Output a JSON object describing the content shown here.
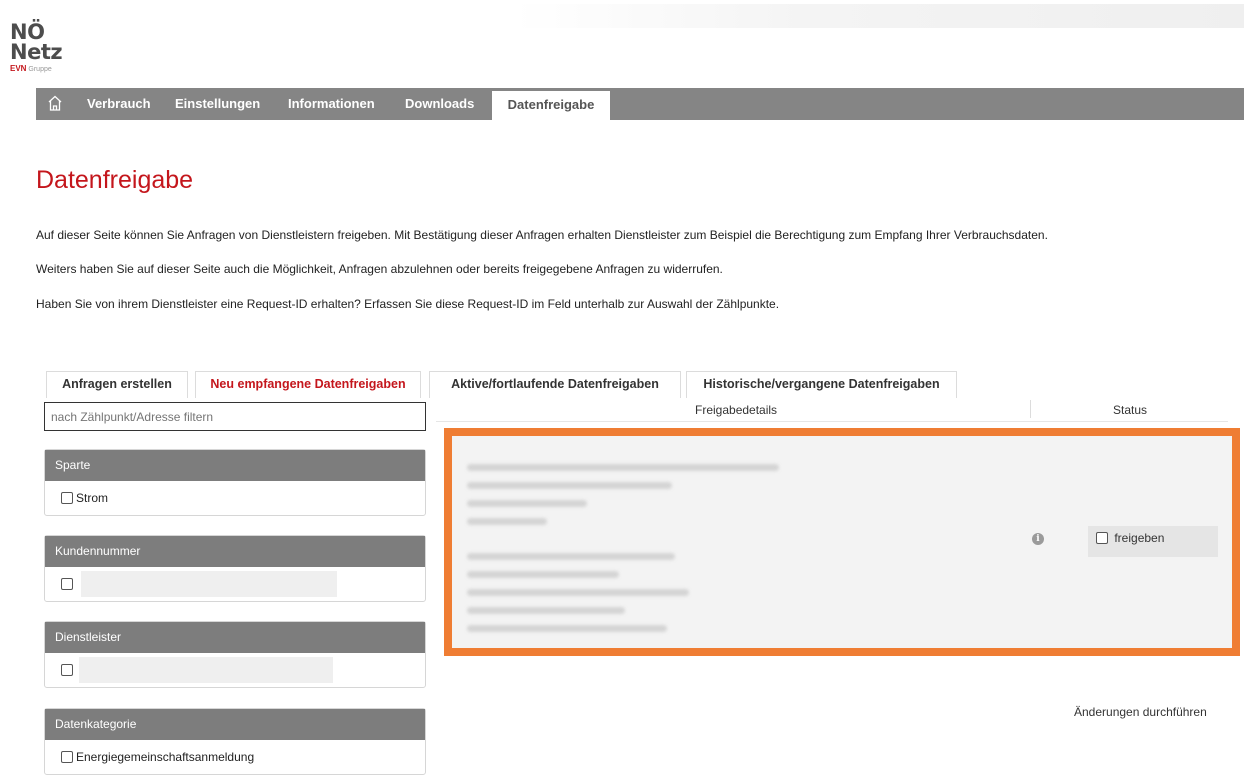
{
  "logo": {
    "line1": "NÖ",
    "line2": "Netz",
    "evn": "EVN",
    "gruppe": "Gruppe"
  },
  "nav": {
    "home_icon": "home-icon",
    "items": [
      "Verbrauch",
      "Einstellungen",
      "Informationen",
      "Downloads",
      "Datenfreigabe"
    ],
    "active": "Datenfreigabe"
  },
  "page": {
    "title": "Datenfreigabe",
    "intro": [
      "Auf dieser Seite können Sie Anfragen von Dienstleistern freigeben. Mit Bestätigung dieser Anfragen erhalten Dienstleister zum Beispiel die Berechtigung zum Empfang Ihrer Verbrauchsdaten.",
      "Weiters haben Sie auf dieser Seite auch die Möglichkeit, Anfragen abzulehnen oder bereits freigegebene Anfragen zu widerrufen.",
      "Haben Sie von ihrem Dienstleister eine Request-ID erhalten? Erfassen Sie diese Request-ID im Feld unterhalb zur Auswahl der Zählpunkte."
    ]
  },
  "tabs": [
    {
      "label": "Anfragen erstellen",
      "active": false
    },
    {
      "label": "Neu empfangene Datenfreigaben",
      "active": true
    },
    {
      "label": "Aktive/fortlaufende Datenfreigaben",
      "active": false
    },
    {
      "label": "Historische/vergangene Datenfreigaben",
      "active": false
    }
  ],
  "filter": {
    "placeholder": "nach Zählpunkt/Adresse filtern"
  },
  "panels": {
    "sparte": {
      "title": "Sparte",
      "option": "Strom"
    },
    "kundennummer": {
      "title": "Kundennummer"
    },
    "dienstleister": {
      "title": "Dienstleister"
    },
    "datenkategorie": {
      "title": "Datenkategorie",
      "option": "Energiegemeinschaftsanmeldung"
    }
  },
  "table": {
    "col_details": "Freigabedetails",
    "col_status": "Status",
    "row": {
      "status_label": "freigeben",
      "info_icon": "info-icon"
    }
  },
  "actions": {
    "apply": "Änderungen durchführen"
  },
  "colors": {
    "brand_red": "#c4161c",
    "nav_gray": "#858585",
    "highlight_orange": "#ef7d33"
  }
}
